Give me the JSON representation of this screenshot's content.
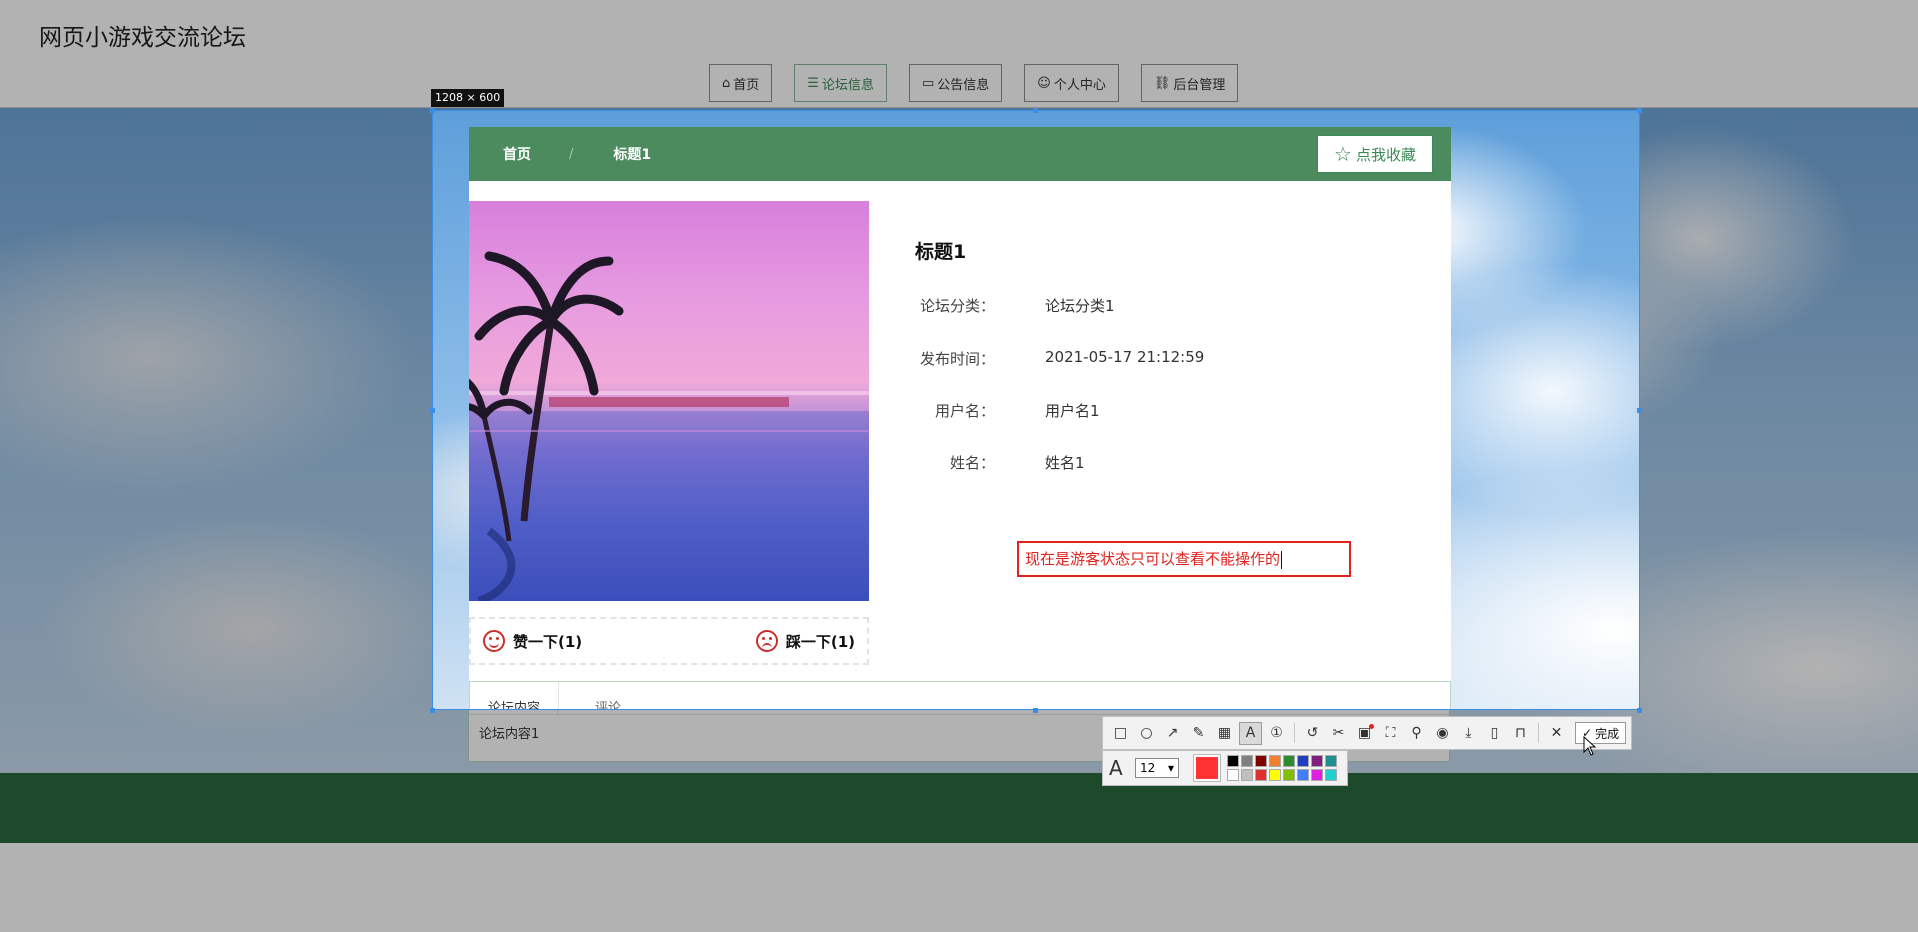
{
  "site": {
    "title": "网页小游戏交流论坛"
  },
  "nav": [
    {
      "label": "首页",
      "icon": "home-icon",
      "glyph": "⌂",
      "active": false
    },
    {
      "label": "论坛信息",
      "icon": "forum-icon",
      "glyph": "☰",
      "active": true
    },
    {
      "label": "公告信息",
      "icon": "notice-icon",
      "glyph": "▭",
      "active": false
    },
    {
      "label": "个人中心",
      "icon": "user-icon",
      "glyph": "☺",
      "active": false
    },
    {
      "label": "后台管理",
      "icon": "link-icon",
      "glyph": "⛓",
      "active": false
    }
  ],
  "selection": {
    "size_label": "1208 × 600"
  },
  "breadcrumb": {
    "home": "首页",
    "separator": "/",
    "current": "标题1"
  },
  "favorite": {
    "label": "点我收藏"
  },
  "votes": {
    "up": "赞一下(1)",
    "down": "踩一下(1)"
  },
  "detail": {
    "title": "标题1",
    "fields": [
      {
        "label": "论坛分类：",
        "value": "论坛分类1"
      },
      {
        "label": "发布时间：",
        "value": "2021-05-17 21:12:59"
      },
      {
        "label": "用户名：",
        "value": "用户名1"
      },
      {
        "label": "姓名：",
        "value": "姓名1"
      }
    ]
  },
  "annotation": {
    "text": "现在是游客状态只可以查看不能操作的"
  },
  "tabs": {
    "content": "论坛内容",
    "comment": "评论",
    "body": "论坛内容1"
  },
  "toolbar": {
    "done_label": "完成",
    "font_size": "12",
    "current_color": "#ff3333",
    "palette_row1": [
      "#000000",
      "#808080",
      "#800000",
      "#f08030",
      "#2e8b2e",
      "#1f3fbf",
      "#7f1f7f",
      "#1f8f8f"
    ],
    "palette_row2": [
      "#ffffff",
      "#c0c0c0",
      "#e03030",
      "#ffff00",
      "#80c000",
      "#3f7fff",
      "#e020e0",
      "#20d0d0"
    ]
  },
  "colors": {
    "accent_green": "#4b8b5e",
    "selection_blue": "#3a8ee6",
    "annotation_red": "#e0231d",
    "footer_green": "#2b6b3f"
  }
}
